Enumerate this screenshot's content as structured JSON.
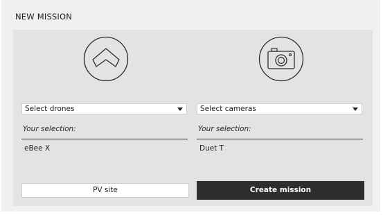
{
  "page": {
    "title": "NEW MISSION"
  },
  "drones": {
    "icon": "drone-wing-icon",
    "dropdown_value": "Select drones",
    "selection_label": "Your selection:",
    "selection_value": "eBee X"
  },
  "cameras": {
    "icon": "camera-icon",
    "dropdown_value": "Select cameras",
    "selection_label": "Your selection:",
    "selection_value": "Duet T"
  },
  "actions": {
    "pv_site_label": "PV site",
    "create_label": "Create mission"
  },
  "colors": {
    "background": "#f0f0f0",
    "panel": "#e3e3e3",
    "dark_button": "#2e2e2e"
  }
}
